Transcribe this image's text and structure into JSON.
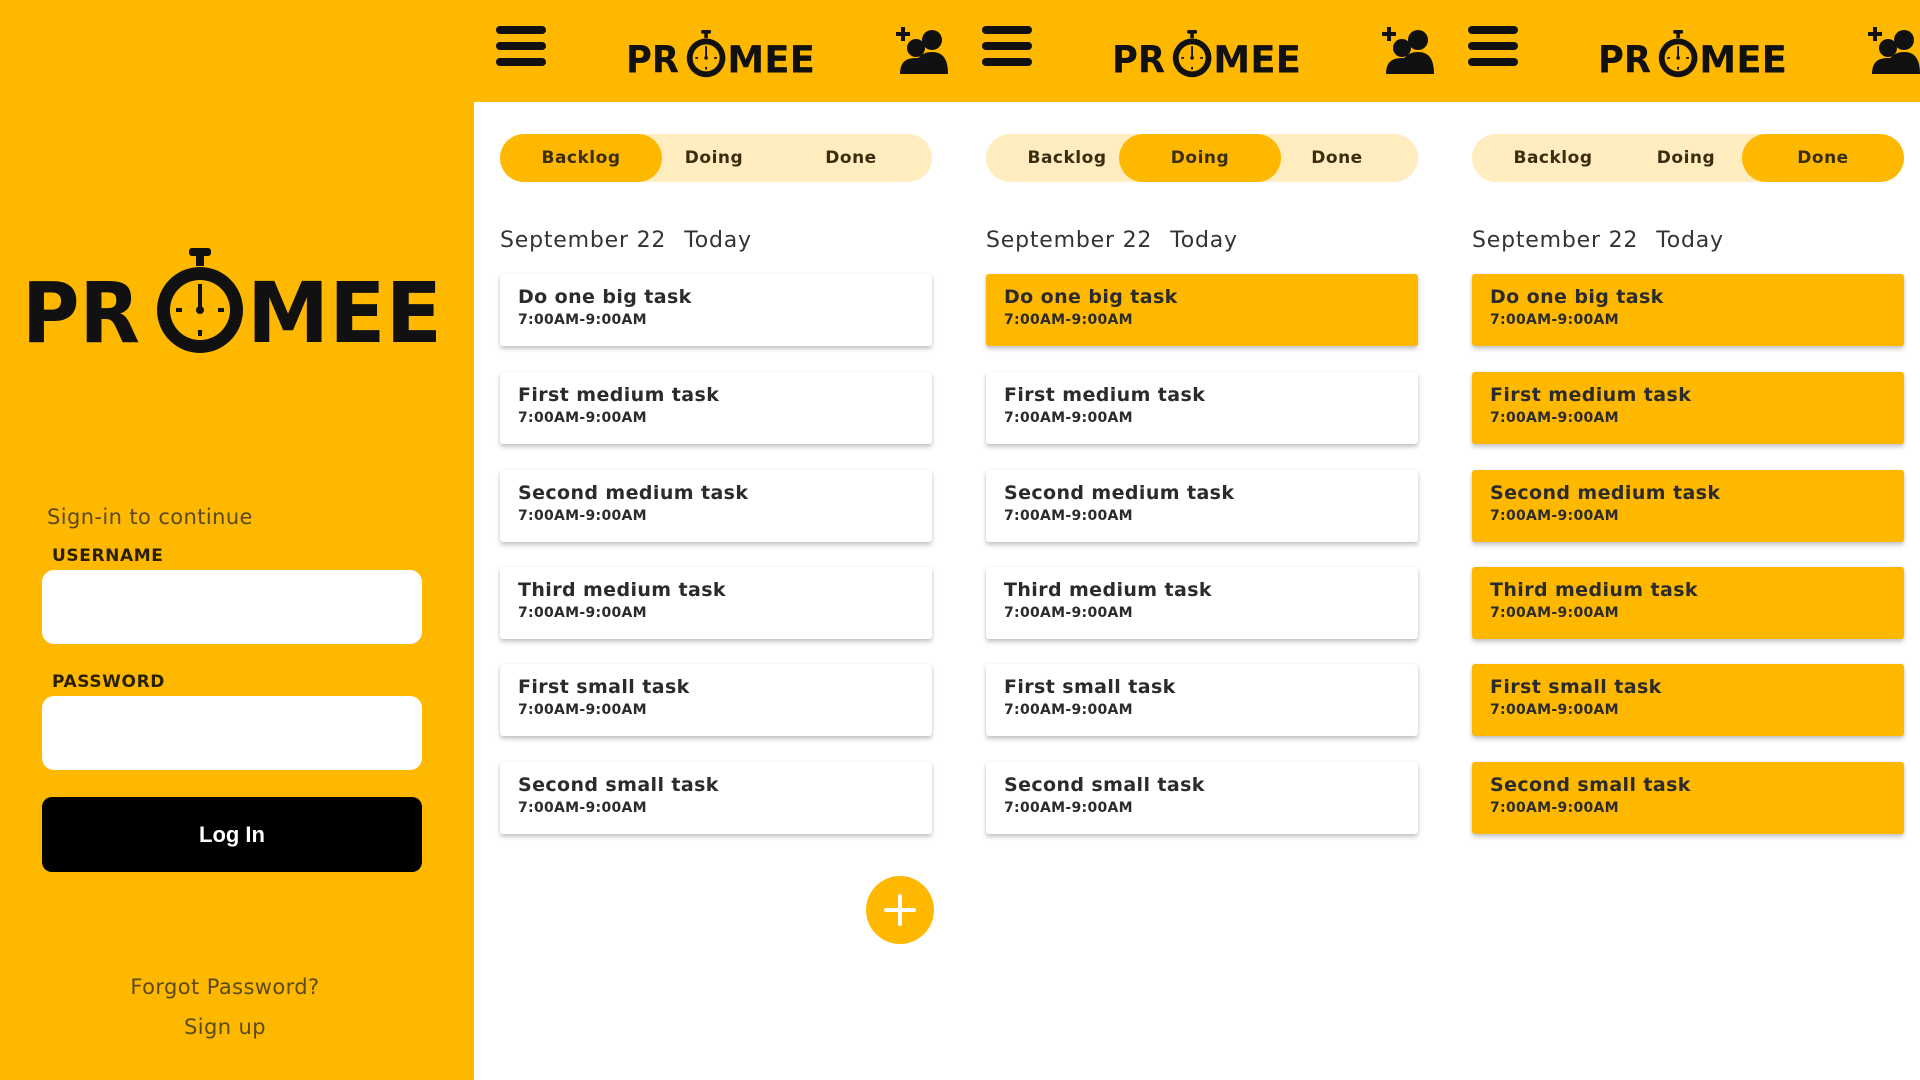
{
  "colors": {
    "accent": "#FFB800",
    "accent_light": "#FFEDC0",
    "dark": "#000000"
  },
  "brand": {
    "logo_text": "PROMEE"
  },
  "login": {
    "subtitle": "Sign-in to continue",
    "username_label": "USERNAME",
    "password_label": "PASSWORD",
    "login_button": "Log In",
    "forgot_password": "Forgot Password?",
    "sign_up": "Sign up"
  },
  "tabs": [
    "Backlog",
    "Doing",
    "Done"
  ],
  "date_label": "September 22",
  "today_label": "Today",
  "tasks": [
    {
      "title": "Do one big task",
      "time": "7:00AM-9:00AM"
    },
    {
      "title": "First medium task",
      "time": "7:00AM-9:00AM"
    },
    {
      "title": "Second medium task",
      "time": "7:00AM-9:00AM"
    },
    {
      "title": "Third medium task",
      "time": "7:00AM-9:00AM"
    },
    {
      "title": "First small task",
      "time": "7:00AM-9:00AM"
    },
    {
      "title": "Second small task",
      "time": "7:00AM-9:00AM"
    }
  ],
  "screens": [
    {
      "active_tab": "Backlog",
      "highlighted_tasks": []
    },
    {
      "active_tab": "Doing",
      "highlighted_tasks": [
        "Do one big task"
      ]
    },
    {
      "active_tab": "Done",
      "highlighted_tasks": [
        "Do one big task",
        "First medium task",
        "Second medium task",
        "Third medium task",
        "First small task",
        "Second small task"
      ]
    }
  ],
  "icons": {
    "menu": "hamburger-menu-icon",
    "add_user": "user-plus-icon",
    "add_task": "plus-icon",
    "logo": "stopwatch-icon"
  }
}
